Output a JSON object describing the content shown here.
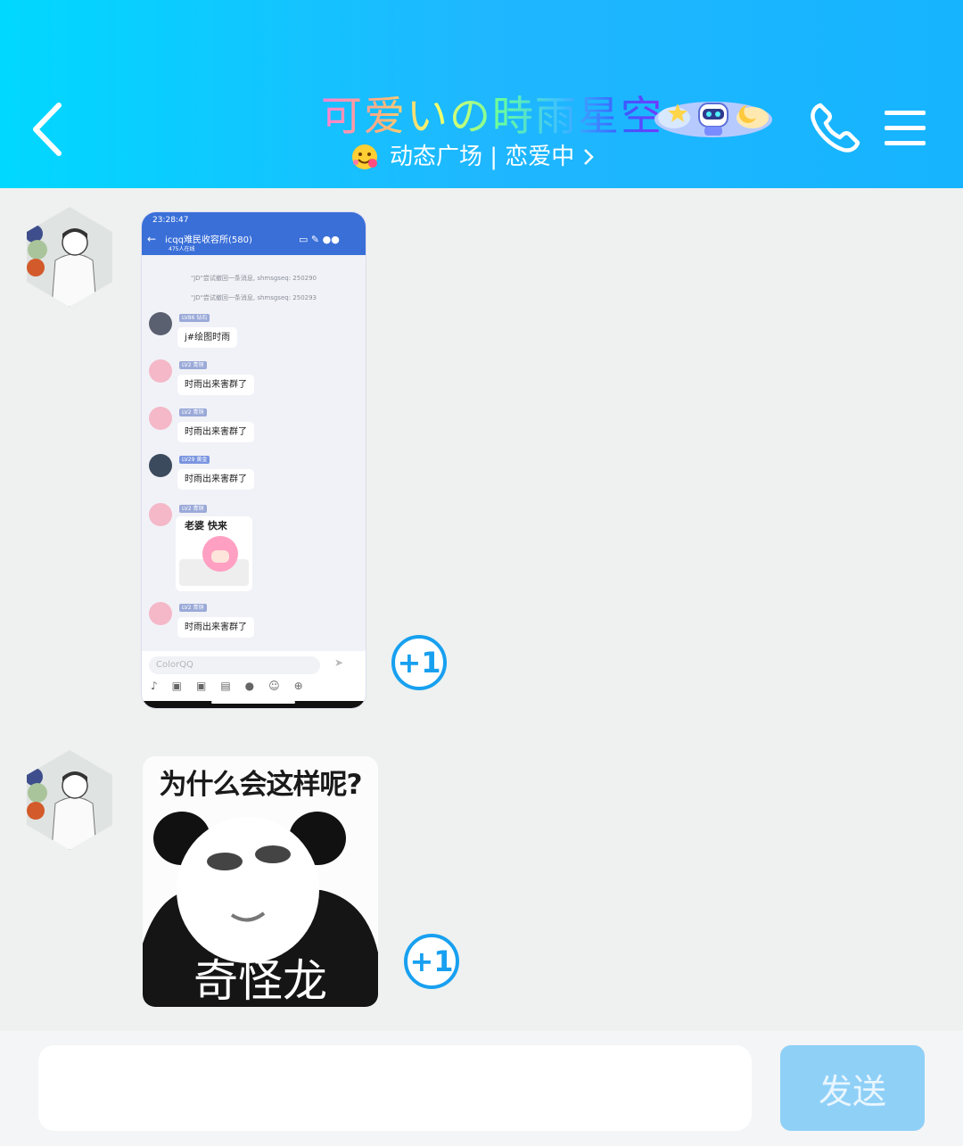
{
  "header": {
    "title": "可爱いの時雨星空",
    "subtitle": "动态广场 | 恋爱中",
    "colors": {
      "gradient_start": "#00d8ff",
      "gradient_end": "#16b4ff"
    },
    "icons": [
      "back-arrow-icon",
      "robot-badge-icon",
      "phone-icon",
      "menu-icon",
      "smile-emoji-icon",
      "chevron-right-icon"
    ]
  },
  "messages": [
    {
      "type": "image-screenshot",
      "plus_one": "+1",
      "screenshot": {
        "status_time": "23:28:47",
        "group_name": "icqq难民收容所(580)",
        "online": "475人在线",
        "system_lines": [
          "\"JD\"尝试撤回一条消息, shmsgseq: 250290",
          "\"JD\"尝试撤回一条消息, shmsgseq: 250293"
        ],
        "chats": [
          {
            "tag": "LV86 钻石",
            "name": "爱读书",
            "text": "j#绘图时雨"
          },
          {
            "tag": "LV2 青铜",
            "name": "JD",
            "text": "时雨出来害群了"
          },
          {
            "tag": "LV2 青铜",
            "name": "JD",
            "text": "时雨出来害群了"
          },
          {
            "tag": "LV29 黄金",
            "name": "·",
            "text": "时雨出来害群了"
          },
          {
            "tag": "LV2 青铜",
            "name": "JD",
            "sticker_text": "老婆 快来"
          },
          {
            "tag": "LV2 青铜",
            "name": "JD",
            "text": "时雨出来害群了"
          }
        ],
        "input_placeholder": "ColorQQ"
      }
    },
    {
      "type": "image-meme",
      "plus_one": "+1",
      "meme": {
        "top_text": "为什么会这样呢?",
        "bottom_text": "奇怪龙"
      }
    }
  ],
  "input": {
    "value": "",
    "placeholder": "",
    "send_label": "发送",
    "send_color": "#8fd0f7"
  }
}
